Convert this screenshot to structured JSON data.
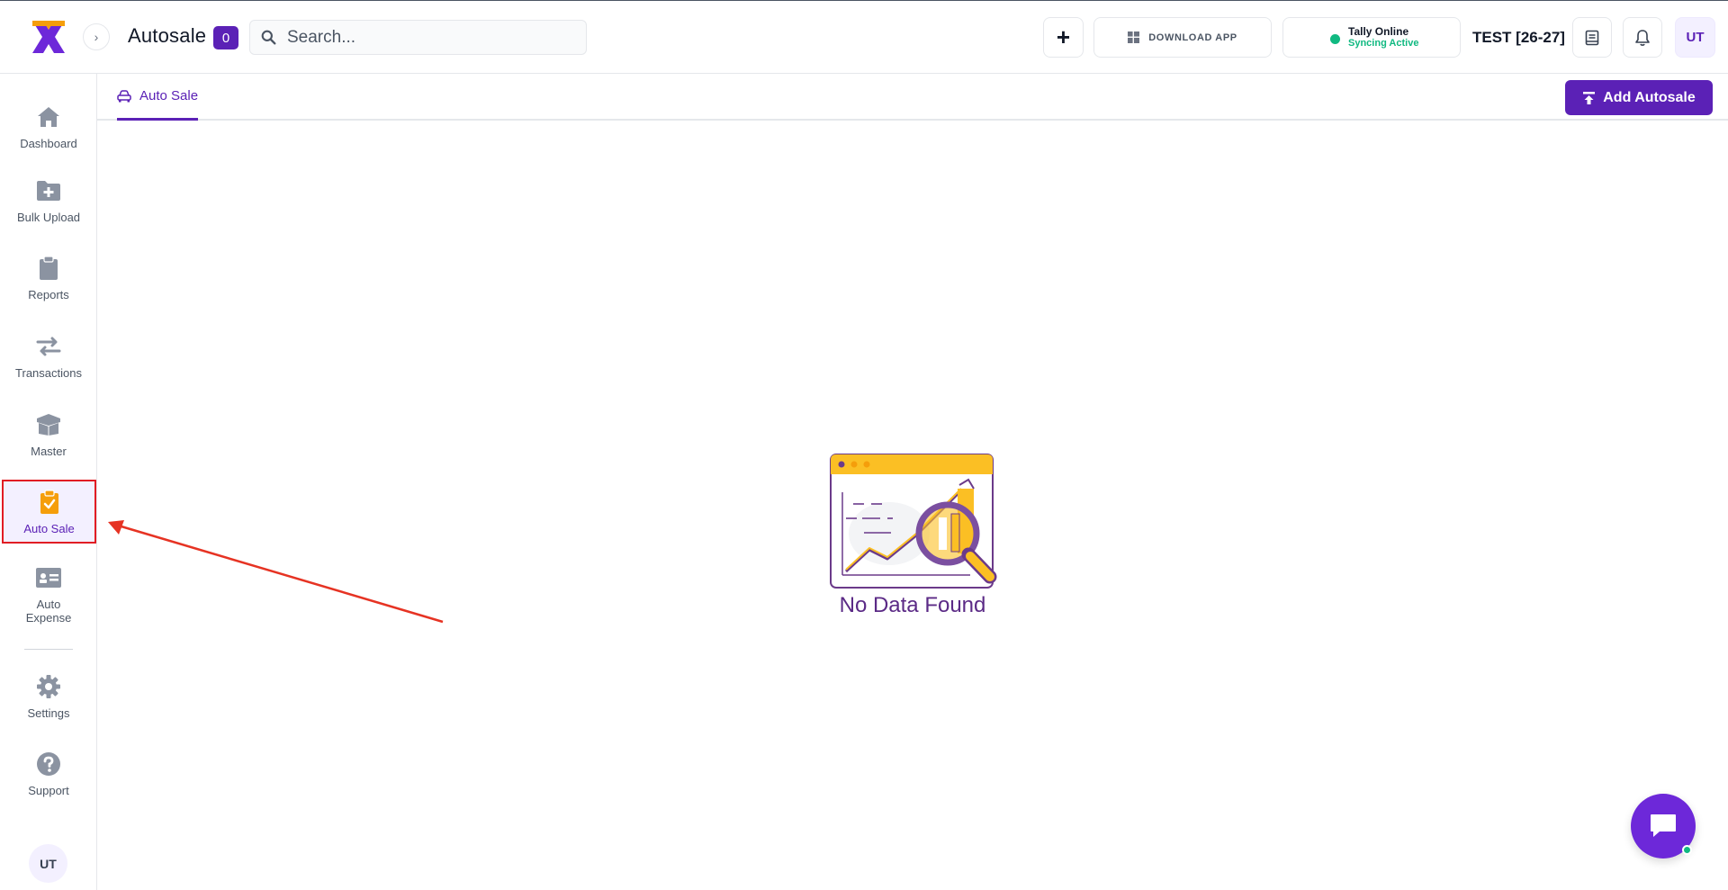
{
  "header": {
    "page_title": "Autosale",
    "count": "0",
    "search_placeholder": "Search...",
    "download_label": "DOWNLOAD APP",
    "tally_status": "Tally Online",
    "tally_sync": "Syncing Active",
    "company": "TEST [26-27]",
    "user_initials": "UT"
  },
  "sidebar": {
    "items": [
      {
        "label": "Dashboard",
        "icon": "home-icon"
      },
      {
        "label": "Bulk Upload",
        "icon": "folder-plus-icon"
      },
      {
        "label": "Reports",
        "icon": "clipboard-icon"
      },
      {
        "label": "Transactions",
        "icon": "arrows-exchange-icon"
      },
      {
        "label": "Master",
        "icon": "box-icon"
      },
      {
        "label": "Auto Sale",
        "icon": "clipboard-check-icon"
      },
      {
        "label": "Auto Expense",
        "icon": "id-card-icon"
      },
      {
        "label": "Settings",
        "icon": "gear-icon"
      },
      {
        "label": "Support",
        "icon": "question-icon"
      }
    ],
    "user_initials": "UT"
  },
  "tabs": [
    {
      "label": "Auto Sale",
      "active": true
    }
  ],
  "actions": {
    "add_label": "Add Autosale"
  },
  "empty_state": {
    "message": "No Data Found"
  },
  "colors": {
    "accent": "#5b21b6",
    "highlight_box": "#e11d24",
    "online": "#10b981",
    "icon_gray": "#8b93a1",
    "illustration_yellow": "#fbbf24"
  }
}
